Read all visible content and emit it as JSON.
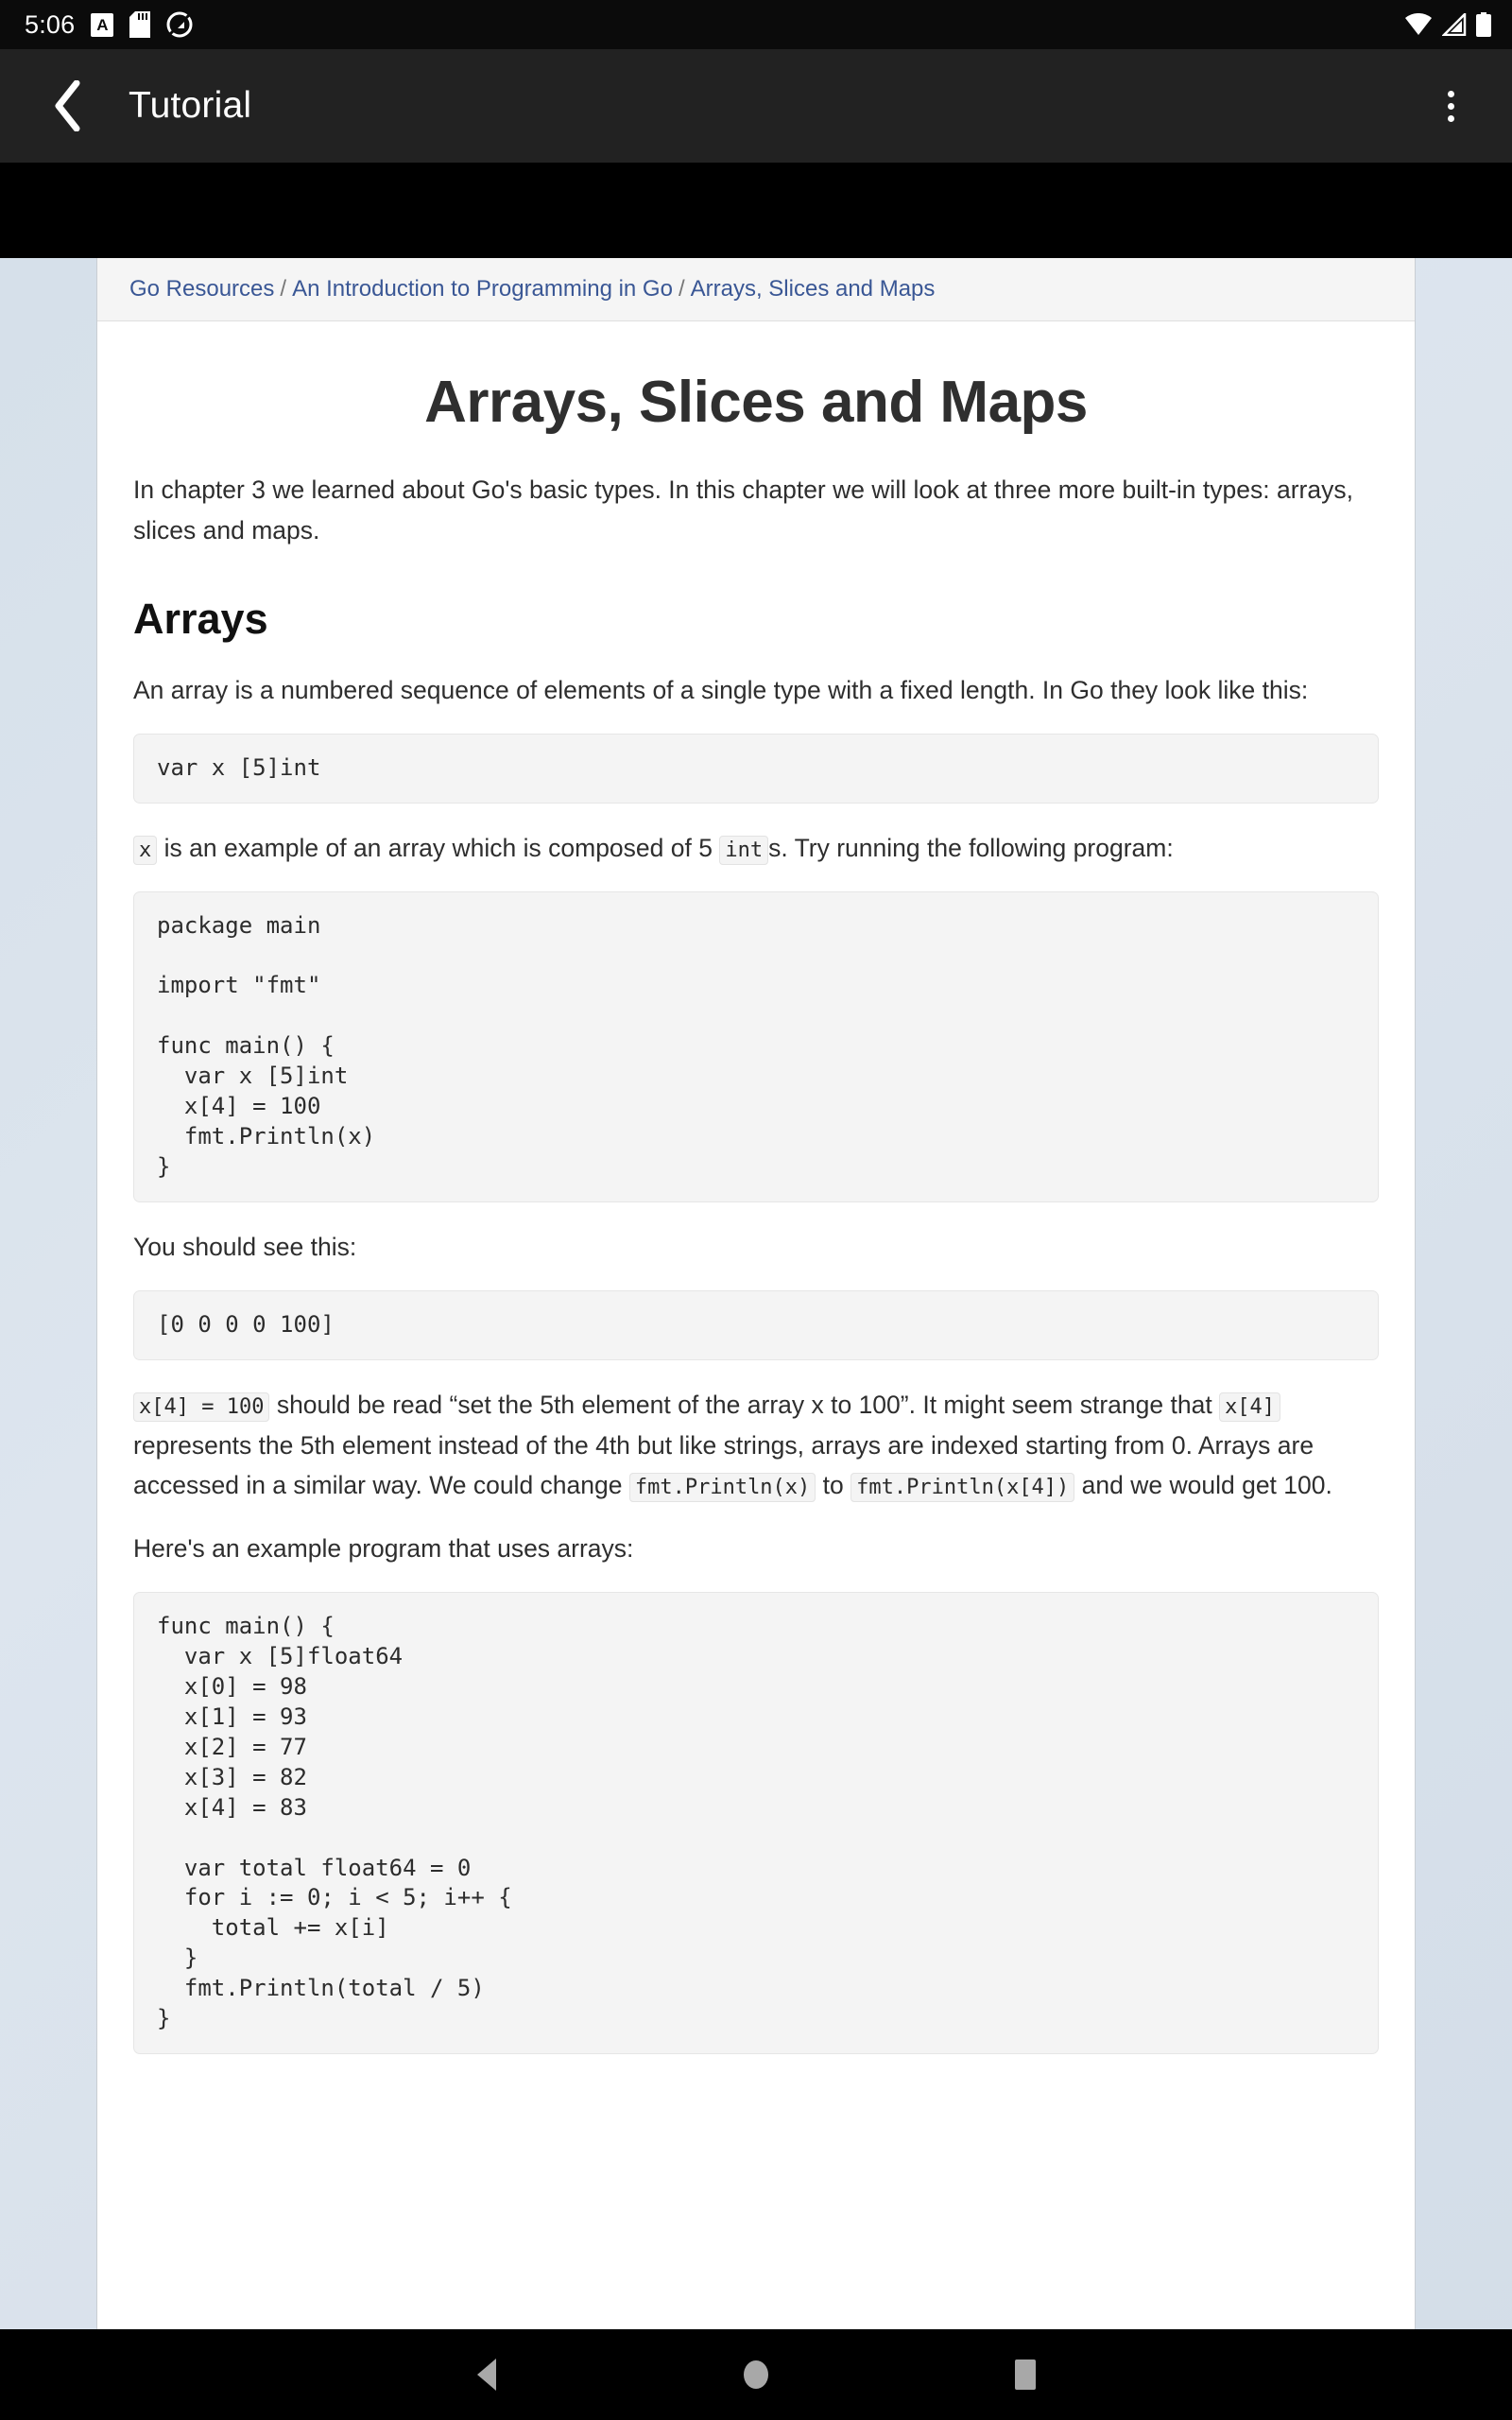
{
  "status_bar": {
    "clock": "5:06",
    "left_icons": [
      "letter-a-badge-icon",
      "sd-card-icon",
      "quest-circle-icon"
    ],
    "right_icons": [
      "wifi-icon",
      "cellular-signal-icon",
      "battery-icon"
    ]
  },
  "app_bar": {
    "back_label": "‹",
    "title": "Tutorial",
    "overflow_label": "more-options"
  },
  "breadcrumb": {
    "items": [
      {
        "label": "Go Resources",
        "current": false
      },
      {
        "label": "An Introduction to Programming in Go",
        "current": false
      },
      {
        "label": "Arrays, Slices and Maps",
        "current": true
      }
    ],
    "separator": "/"
  },
  "page": {
    "title": "Arrays, Slices and Maps",
    "intro": "In chapter 3 we learned about Go's basic types. In this chapter we will look at three more built-in types: arrays, slices and maps.",
    "section_arrays_title": "Arrays",
    "arrays_intro": "An array is a numbered sequence of elements of a single type with a fixed length. In Go they look like this:",
    "code_var_decl": "var x [5]int",
    "para_x_example_part1": " is an example of an array which is composed of 5 ",
    "inline_x": "x",
    "inline_int": "int",
    "para_x_example_part2": "s. Try running the following program:",
    "code_program_1": "package main\n\nimport \"fmt\"\n\nfunc main() {\n  var x [5]int\n  x[4] = 100\n  fmt.Println(x)\n}",
    "should_see": "You should see this:",
    "code_output_1": "[0 0 0 0 100]",
    "explain_inline_1": "x[4] = 100",
    "explain_part1": " should be read “set the 5th element of the array x to 100”. It might seem strange that ",
    "explain_inline_2": "x[4]",
    "explain_part2": " represents the 5th element instead of the 4th but like strings, arrays are indexed starting from 0. Arrays are accessed in a similar way. We could change ",
    "explain_inline_3": "fmt.Println(x)",
    "explain_part3": " to ",
    "explain_inline_4": "fmt.Println(x[4])",
    "explain_part4": " and we would get 100.",
    "example_intro": "Here's an example program that uses arrays:",
    "code_program_2": "func main() {\n  var x [5]float64\n  x[0] = 98\n  x[1] = 93\n  x[2] = 77\n  x[3] = 82\n  x[4] = 83\n\n  var total float64 = 0\n  for i := 0; i < 5; i++ {\n    total += x[i]\n  }\n  fmt.Println(total / 5)\n}"
  },
  "nav_bar": {
    "back": "back-triangle",
    "home": "home-circle",
    "recents": "recents-square"
  },
  "colors": {
    "link": "#3a5795",
    "app_bar": "#222222",
    "status_bar": "#0b0b0b",
    "code_bg": "#f4f4f4",
    "page_bg": "#d6e0ea"
  }
}
